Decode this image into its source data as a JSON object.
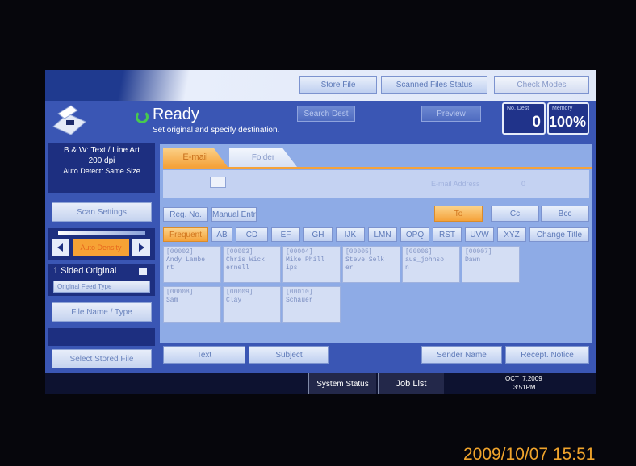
{
  "top_buttons": {
    "store_file": "Store File",
    "scanned_files_status": "Scanned Files Status",
    "check_modes": "Check Modes"
  },
  "status": {
    "title": "Ready",
    "subtitle": "Set original and specify destination.",
    "search_dest": "Search Dest",
    "preview": "Preview"
  },
  "counters": {
    "no_dest_label": "No. Dest",
    "no_dest_value": "0",
    "memory_label": "Memory",
    "memory_value": "100%"
  },
  "left_panel": {
    "mode_line1": "B & W: Text / Line Art",
    "mode_line2": "200 dpi",
    "mode_line3": "Auto Detect: Same Size",
    "scan_settings": "Scan Settings",
    "density_label": "Auto Density",
    "sided_original": "1 Sided Original",
    "original_feed_type": "Original Feed Type",
    "file_name_type": "File Name / Type",
    "select_stored_file": "Select Stored File"
  },
  "tabs": {
    "email": "E-mail",
    "folder": "Folder"
  },
  "email_address_label": "E-mail Address",
  "email_address_count": "0",
  "reg_no": "Reg. No.",
  "manual_entry": "Manual Entr",
  "recipient_types": {
    "to": "To",
    "cc": "Cc",
    "bcc": "Bcc"
  },
  "index_tabs": [
    "Frequent",
    "AB",
    "CD",
    "EF",
    "GH",
    "IJK",
    "LMN",
    "OPQ",
    "RST",
    "UVW",
    "XYZ",
    "Change Title"
  ],
  "entries": [
    {
      "key": "[00002]",
      "name": "Andy Lambe",
      "name2": "rt"
    },
    {
      "key": "[00003]",
      "name": "Chris Wick",
      "name2": "ernell"
    },
    {
      "key": "[00004]",
      "name": "Mike Phill",
      "name2": "ips"
    },
    {
      "key": "[00005]",
      "name": "Steve Selk",
      "name2": "er"
    },
    {
      "key": "[00006]",
      "name": "aus_johnso",
      "name2": "n"
    },
    {
      "key": "[00007]",
      "name": "Dawn",
      "name2": ""
    },
    {
      "key": "[00008]",
      "name": "Sam",
      "name2": ""
    },
    {
      "key": "[00009]",
      "name": "Clay",
      "name2": ""
    },
    {
      "key": "[00010]",
      "name": "Schauer",
      "name2": ""
    }
  ],
  "bottom_buttons": {
    "text": "Text",
    "subject": "Subject",
    "sender_name": "Sender Name",
    "recept_notice": "Recept. Notice"
  },
  "footer": {
    "system_status": "System Status",
    "job_list": "Job List",
    "date": "OCT  7,2009",
    "time": "3:51PM"
  },
  "photo_timestamp": "2009/10/07 15:51",
  "colors": {
    "accent_orange": "#f5a23a",
    "panel_navy": "#1d2f80",
    "screen_blue": "#3a56b4"
  }
}
